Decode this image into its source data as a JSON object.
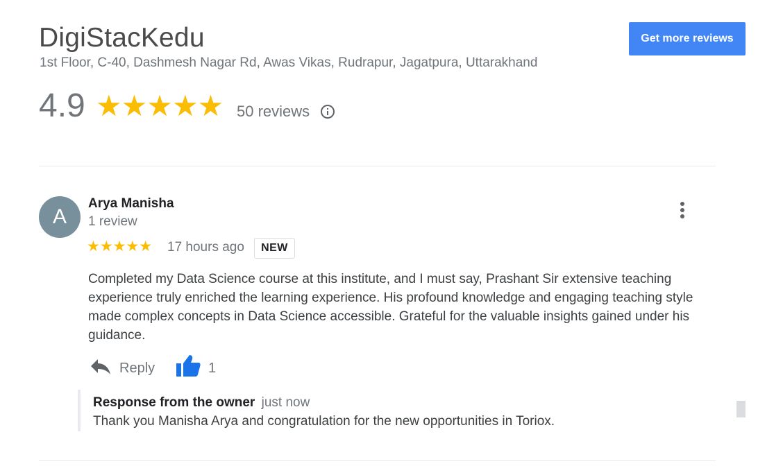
{
  "business": {
    "name": "DigiStacKedu",
    "address": "1st Floor, C-40, Dashmesh Nagar Rd, Awas Vikas, Rudrapur, Jagatpura, Uttarakhand",
    "rating": "4.9",
    "stars_display": "★★★★★",
    "review_count_label": "50 reviews",
    "info_icon": "info-circle-icon"
  },
  "header": {
    "get_more_reviews_label": "Get more reviews"
  },
  "colors": {
    "accent_blue": "#4285f4",
    "star_yellow": "#fbbc04",
    "avatar_bg": "#78909c",
    "like_blue": "#1a73e8",
    "muted_text": "#70757a"
  },
  "review": {
    "avatar_initial": "A",
    "reviewer_name": "Arya Manisha",
    "reviewer_meta": "1 review",
    "stars_display": "★★★★★",
    "rating": 5,
    "time": "17 hours ago",
    "badge": "NEW",
    "text": "Completed my Data Science course at this institute, and I must say, Prashant Sir extensive teaching experience truly enriched the learning experience. His profound knowledge and engaging teaching style made complex concepts in Data Science accessible. Grateful for the valuable insights gained under his guidance.",
    "actions": {
      "reply_label": "Reply",
      "reply_icon": "reply-arrow-icon",
      "like_icon": "thumbs-up-icon",
      "like_count": "1"
    },
    "menu_icon": "more-vert-icon",
    "owner_response": {
      "title": "Response from the owner",
      "time": "just now",
      "text": "Thank you Manisha Arya and congratulation for the new opportunities in Toriox."
    }
  }
}
